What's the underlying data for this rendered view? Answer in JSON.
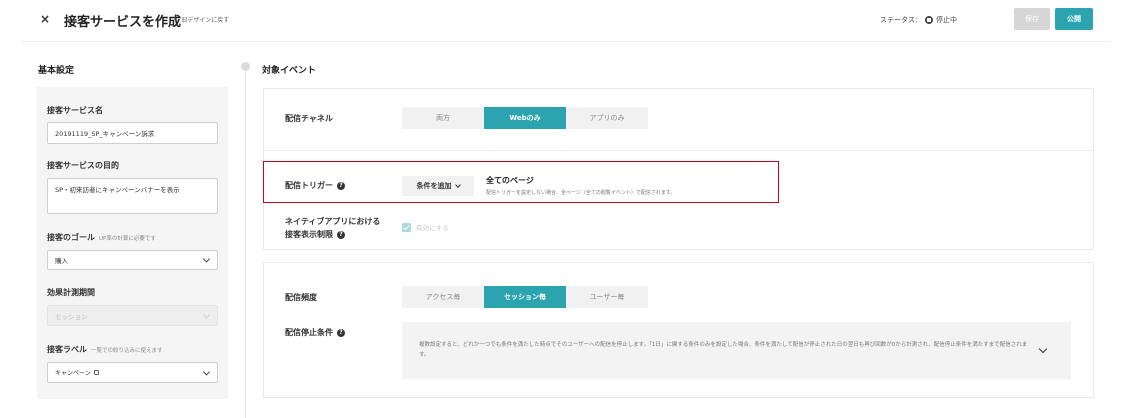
{
  "header": {
    "close_icon": "×",
    "title": "接客サービスを作成",
    "revert_icon": "C",
    "revert_label": "旧デザインに戻す",
    "status_label": "ステータス：",
    "status_value": "停止中",
    "save_label": "保存",
    "publish_label": "公開"
  },
  "left": {
    "heading": "基本設定",
    "name_label": "接客サービス名",
    "name_value": "20191119_SP_キャンペーン訴求",
    "purpose_label": "接客サービスの目的",
    "purpose_value": "SP・初来訪者にキャンペーンバナーを表示",
    "goal_label": "接客のゴール",
    "goal_sub": "UP率の計算に必要です",
    "goal_value": "購入",
    "period_label": "効果計測期間",
    "period_value": "セッション",
    "tag_label": "接客ラベル",
    "tag_sub": "一覧での絞り込みに使えます",
    "tag_value": "キャンペーン"
  },
  "right": {
    "heading": "対象イベント",
    "channel_label": "配信チャネル",
    "channel_options": [
      "両方",
      "Webのみ",
      "アプリのみ"
    ],
    "channel_selected": 1,
    "trigger_label": "配信トリガー",
    "trigger_button": "条件を追加",
    "trigger_title": "全てのページ",
    "trigger_desc": "配信トリガーを設定しない場合、全ページ（全ての閲覧イベント）で配信されます。",
    "native_label_line1": "ネイティブアプリにおける",
    "native_label_line2": "接客表示制限",
    "native_checkbox": "有効にする",
    "freq_label": "配信頻度",
    "freq_options": [
      "アクセス毎",
      "セッション毎",
      "ユーザー毎"
    ],
    "freq_selected": 1,
    "stop_label": "配信停止条件",
    "stop_text": "複数設定すると、どれか一つでも条件を満たした時点でそのユーザーへの配信を停止します。「1日」に関する条件のみを設定した場合、条件を満たして配信が停止された日の翌日も再び回数が0から計測され、配信停止条件を満たすまで配信されます。"
  },
  "colors": {
    "accent": "#2ba4b0",
    "highlight_border": "#d0021b"
  }
}
